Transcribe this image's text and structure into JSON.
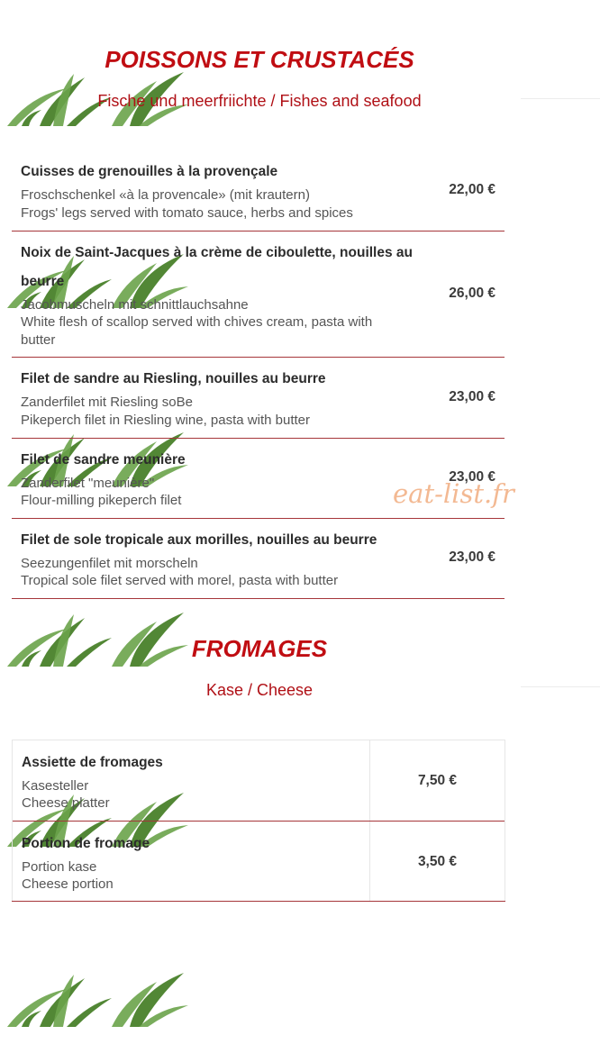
{
  "poissons": {
    "title": "POISSONS ET CRUSTACÉS",
    "subtitle": "Fische und meerfriichte / Fishes and seafood",
    "items": [
      {
        "name": "Cuisses de grenouilles à la provençale",
        "de": "Froschschenkel «à la provencale» (mit krautern)",
        "en": "Frogs' legs served with tomato sauce, herbs and spices",
        "price": "22,00 €"
      },
      {
        "name": "Noix de Saint-Jacques à la crème de ciboulette, nouilles au beurre",
        "de": "Jacobmuscheln mit schnittlauchsahne",
        "en": "White flesh of scallop served with chives cream, pasta with butter",
        "price": "26,00 €"
      },
      {
        "name": "Filet de sandre au Riesling, nouilles au beurre",
        "de": "Zanderfilet mit Riesling soBe",
        "en": "Pikeperch filet in Riesling wine, pasta with butter",
        "price": "23,00 €"
      },
      {
        "name": "Filet de sandre meunière",
        "de": "Zanderfilet \"meunière\"",
        "en": "Flour-milling pikeperch filet",
        "price": "23,00 €"
      },
      {
        "name": "Filet de sole tropicale aux morilles, nouilles au beurre",
        "de": "Seezungenfilet mit morscheln",
        "en": "Tropical sole filet served with morel, pasta with butter",
        "price": "23,00 €"
      }
    ]
  },
  "fromages": {
    "title": "FROMAGES",
    "subtitle": "Kase / Cheese",
    "items": [
      {
        "name": "Assiette de fromages",
        "de": "Kasesteller",
        "en": "Cheese platter",
        "price": "7,50 €"
      },
      {
        "name": "Portion de fromage",
        "de": "Portion kase",
        "en": "Cheese portion",
        "price": "3,50 €"
      }
    ]
  },
  "watermark": "eat-list.fr",
  "colors": {
    "title": "#c00d12",
    "subtitle": "#b01016",
    "divider": "#a6363a",
    "watermark": "#f2b48a",
    "grass": "#3f7a1f"
  }
}
